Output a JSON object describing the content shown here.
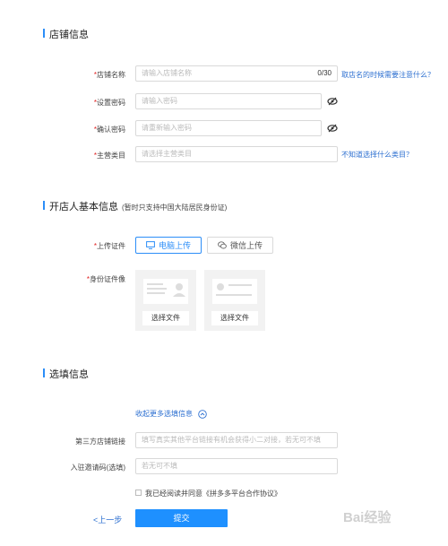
{
  "section_shop": {
    "title": "店铺信息"
  },
  "shop_name": {
    "label": "店铺名称",
    "placeholder": "请输入店铺名称",
    "count": "0/30",
    "help_link": "取店名的时候需要注意什么？"
  },
  "set_password": {
    "label": "设置密码",
    "placeholder": "请输入密码"
  },
  "confirm_password": {
    "label": "确认密码",
    "placeholder": "请重新输入密码"
  },
  "category": {
    "label": "主营类目",
    "placeholder": "请选择主营类目",
    "help_link": "不知道选择什么类目？"
  },
  "section_owner": {
    "title": "开店人基本信息",
    "note": "(暂时只支持中国大陆居民身份证)"
  },
  "upload_id": {
    "label": "上传证件",
    "pc_upload": "电脑上传",
    "wechat_upload": "微信上传"
  },
  "id_image": {
    "label": "身份证件像",
    "front_button": "选择文件",
    "back_button": "选择文件"
  },
  "section_optional": {
    "title": "选填信息"
  },
  "collapse_link": "收起更多选填信息",
  "third_party_link": {
    "label": "第三方店铺链接",
    "placeholder": "填写真实其他平台链接有机会获得小二对接，若无可不填"
  },
  "invite_code": {
    "label": "入驻邀请码(选填)",
    "placeholder": "若无可不填"
  },
  "agreement": {
    "prefix": "我已经阅读并同意",
    "link": "《拼多多平台合作协议》"
  },
  "nav": {
    "prev": "<上一步",
    "submit": "提交"
  },
  "required_mark": "*",
  "watermark": "Bai经验",
  "colors": {
    "accent": "#2c8ef8",
    "submit": "#1e90ff",
    "required": "#e02020",
    "link": "#2c6fd0"
  }
}
